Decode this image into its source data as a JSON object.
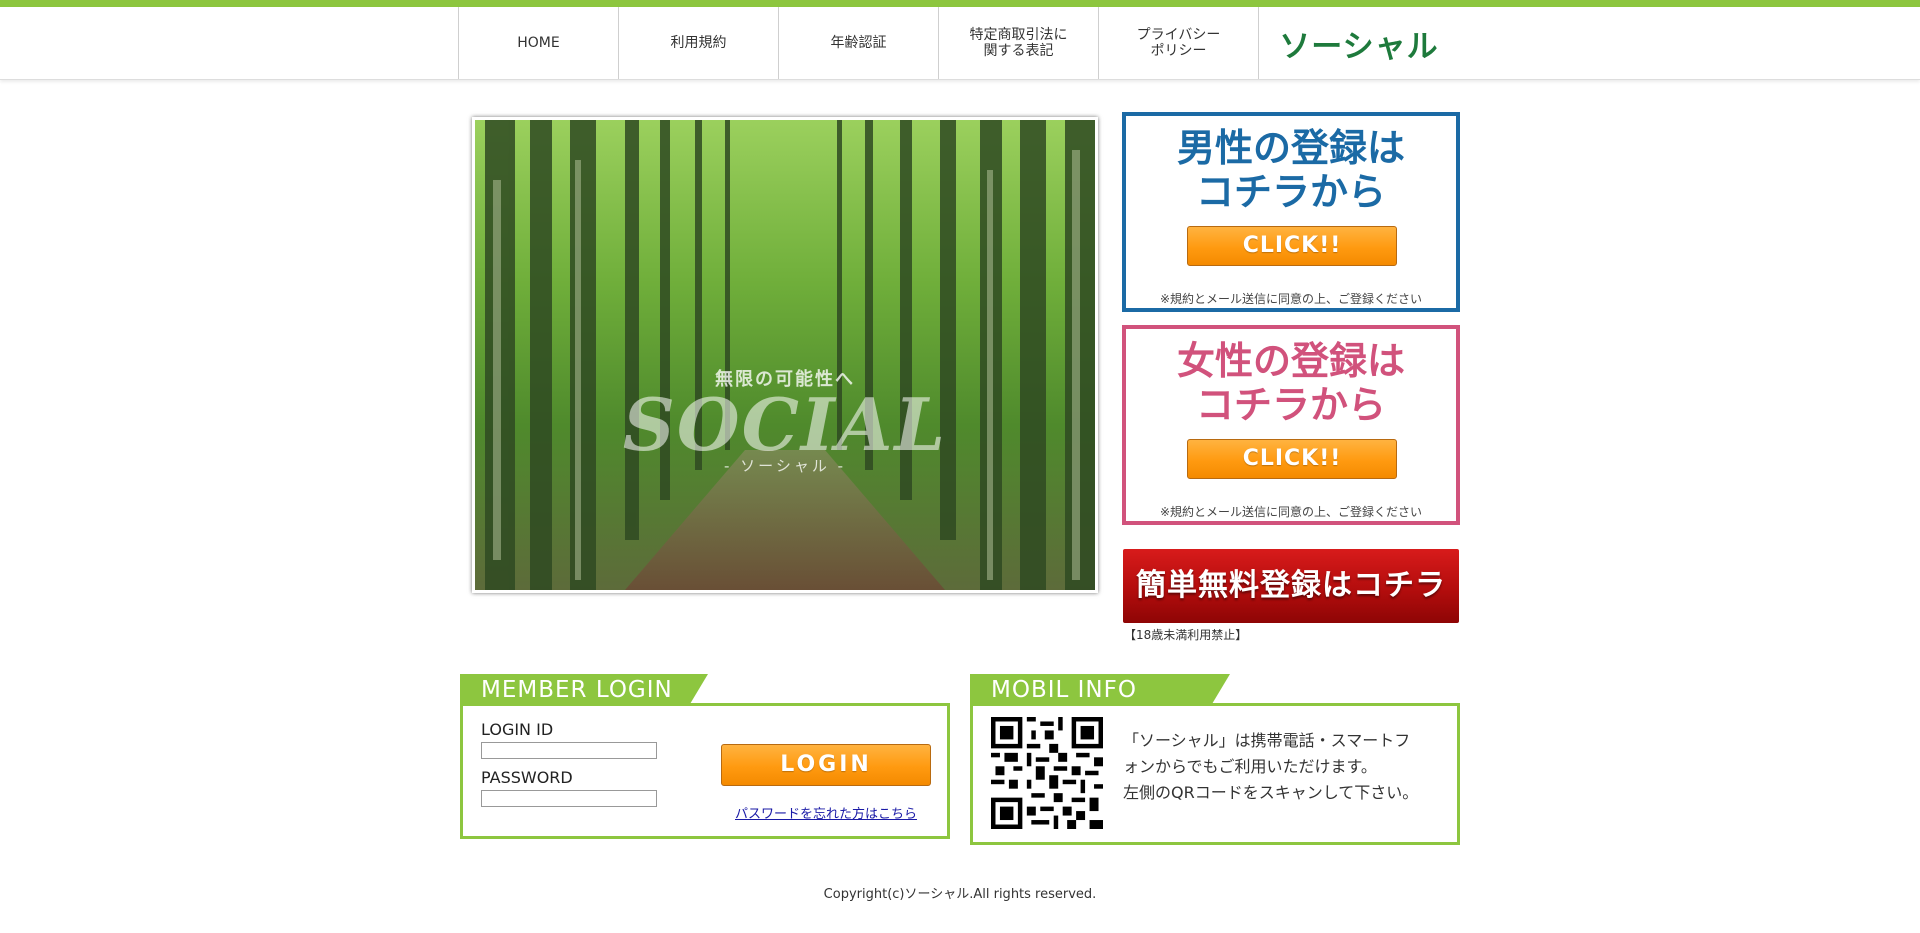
{
  "nav": {
    "items": [
      {
        "label": "HOME"
      },
      {
        "label": "利用規約"
      },
      {
        "label": "年齢認証"
      },
      {
        "label": "特定商取引法に\n関する表記"
      },
      {
        "label": "プライバシー\nポリシー"
      }
    ],
    "logo": "ソーシャル"
  },
  "hero": {
    "tagline": "無限の可能性へ",
    "brand": "SOCIAL",
    "sub": "- ソーシャル -"
  },
  "register": {
    "male": {
      "title": "男性の登録は\nコチラから",
      "button": "CLICK!!",
      "note": "※規約とメール送信に同意の上、ご登録ください"
    },
    "female": {
      "title": "女性の登録は\nコチラから",
      "button": "CLICK!!",
      "note": "※規約とメール送信に同意の上、ご登録ください"
    },
    "free": "簡単無料登録はコチラ",
    "age_note": "【18歳未満利用禁止】"
  },
  "login": {
    "heading": "MEMBER LOGIN",
    "id_label": "LOGIN ID",
    "id_value": "",
    "password_label": "PASSWORD",
    "password_value": "",
    "button": "LOGIN",
    "forgot": "パスワードを忘れた方はこちら"
  },
  "mobil": {
    "heading": "MOBIL INFO",
    "text": "「ソーシャル」は携帯電話・スマートフ\nォンからでもご利用いただけます。\n左側のQRコードをスキャンして下さい。"
  },
  "footer": "Copyright(c)ソーシャル.All rights reserved.",
  "colors": {
    "accent": "#8dc63f",
    "male": "#1b6aa5",
    "female": "#d1527c",
    "button": "#ff9a10",
    "free": "#c81414",
    "logo": "#1e7a3c"
  }
}
